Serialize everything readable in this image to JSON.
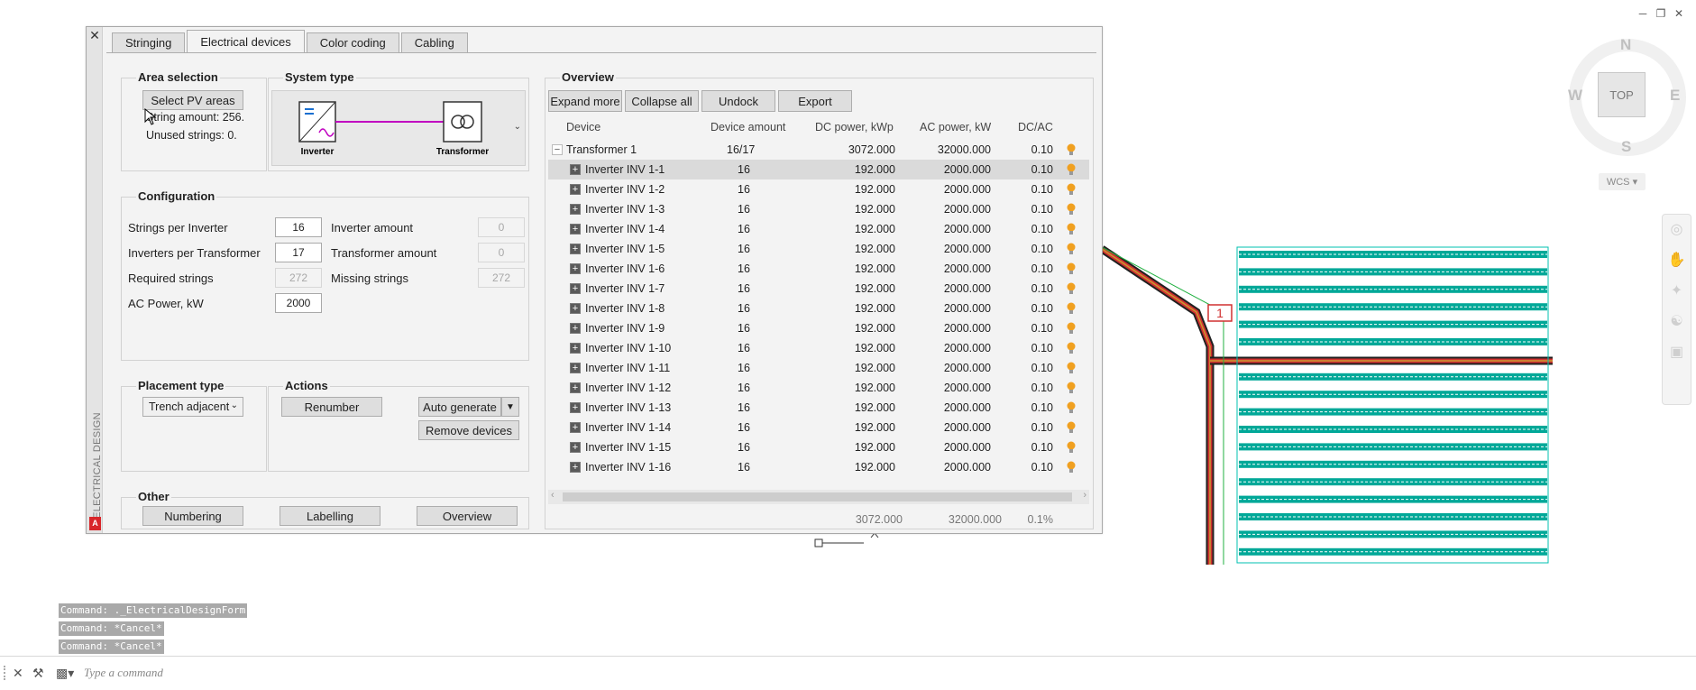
{
  "window_controls": [
    "minimize-icon",
    "restore-icon",
    "close-icon"
  ],
  "viewcube": {
    "top": "TOP",
    "n": "N",
    "s": "S",
    "e": "E",
    "w": "W",
    "wcs": "WCS"
  },
  "drawing": {
    "marker_label": "1"
  },
  "dialog": {
    "close": "✕",
    "side_label": "ELECTRICAL DESIGN",
    "logo": "A",
    "tabs": [
      "Stringing",
      "Electrical devices",
      "Color coding",
      "Cabling"
    ],
    "active_tab": 1,
    "area_selection": {
      "title": "Area selection",
      "select_button": "Select PV areas",
      "string_amount": "String amount: 256.",
      "unused_strings": "Unused strings: 0."
    },
    "system_type": {
      "title": "System type",
      "inverter_label": "Inverter",
      "transformer_label": "Transformer"
    },
    "configuration": {
      "title": "Configuration",
      "strings_per_inverter_label": "Strings per Inverter",
      "strings_per_inverter": "16",
      "inverters_per_transformer_label": "Inverters per Transformer",
      "inverters_per_transformer": "17",
      "required_strings_label": "Required strings",
      "required_strings": "272",
      "ac_power_label": "AC Power, kW",
      "ac_power": "2000",
      "inverter_amount_label": "Inverter amount",
      "inverter_amount": "0",
      "transformer_amount_label": "Transformer amount",
      "transformer_amount": "0",
      "missing_strings_label": "Missing strings",
      "missing_strings": "272"
    },
    "placement": {
      "title": "Placement type",
      "selected": "Trench adjacent"
    },
    "actions": {
      "title": "Actions",
      "renumber": "Renumber",
      "auto_generate": "Auto generate",
      "remove_devices": "Remove devices"
    },
    "other": {
      "title": "Other",
      "numbering": "Numbering",
      "labelling": "Labelling",
      "overview": "Overview"
    },
    "overview": {
      "title": "Overview",
      "expand_more": "Expand more",
      "collapse_all": "Collapse all",
      "undock": "Undock",
      "export": "Export",
      "columns": [
        "Device",
        "Device amount",
        "DC power, kWp",
        "AC power, kW",
        "DC/AC"
      ],
      "transformer_row": {
        "device": "Transformer 1",
        "amount": "16/17",
        "dc": "3072.000",
        "ac": "32000.000",
        "ratio": "0.10"
      },
      "rows": [
        {
          "device": "Inverter INV 1-1",
          "amount": "16",
          "dc": "192.000",
          "ac": "2000.000",
          "ratio": "0.10"
        },
        {
          "device": "Inverter INV 1-2",
          "amount": "16",
          "dc": "192.000",
          "ac": "2000.000",
          "ratio": "0.10"
        },
        {
          "device": "Inverter INV 1-3",
          "amount": "16",
          "dc": "192.000",
          "ac": "2000.000",
          "ratio": "0.10"
        },
        {
          "device": "Inverter INV 1-4",
          "amount": "16",
          "dc": "192.000",
          "ac": "2000.000",
          "ratio": "0.10"
        },
        {
          "device": "Inverter INV 1-5",
          "amount": "16",
          "dc": "192.000",
          "ac": "2000.000",
          "ratio": "0.10"
        },
        {
          "device": "Inverter INV 1-6",
          "amount": "16",
          "dc": "192.000",
          "ac": "2000.000",
          "ratio": "0.10"
        },
        {
          "device": "Inverter INV 1-7",
          "amount": "16",
          "dc": "192.000",
          "ac": "2000.000",
          "ratio": "0.10"
        },
        {
          "device": "Inverter INV 1-8",
          "amount": "16",
          "dc": "192.000",
          "ac": "2000.000",
          "ratio": "0.10"
        },
        {
          "device": "Inverter INV 1-9",
          "amount": "16",
          "dc": "192.000",
          "ac": "2000.000",
          "ratio": "0.10"
        },
        {
          "device": "Inverter INV 1-10",
          "amount": "16",
          "dc": "192.000",
          "ac": "2000.000",
          "ratio": "0.10"
        },
        {
          "device": "Inverter INV 1-11",
          "amount": "16",
          "dc": "192.000",
          "ac": "2000.000",
          "ratio": "0.10"
        },
        {
          "device": "Inverter INV 1-12",
          "amount": "16",
          "dc": "192.000",
          "ac": "2000.000",
          "ratio": "0.10"
        },
        {
          "device": "Inverter INV 1-13",
          "amount": "16",
          "dc": "192.000",
          "ac": "2000.000",
          "ratio": "0.10"
        },
        {
          "device": "Inverter INV 1-14",
          "amount": "16",
          "dc": "192.000",
          "ac": "2000.000",
          "ratio": "0.10"
        },
        {
          "device": "Inverter INV 1-15",
          "amount": "16",
          "dc": "192.000",
          "ac": "2000.000",
          "ratio": "0.10"
        },
        {
          "device": "Inverter INV 1-16",
          "amount": "16",
          "dc": "192.000",
          "ac": "2000.000",
          "ratio": "0.10"
        }
      ],
      "totals": {
        "dc": "3072.000",
        "ac": "32000.000",
        "ratio": "0.1%"
      }
    }
  },
  "command_history": [
    "Command: ._ElectricalDesignForm",
    "Command: *Cancel*",
    "Command: *Cancel*"
  ],
  "command_placeholder": "Type a command",
  "colors": {
    "accent_line": "#c000c0",
    "bulb": "#f0a020",
    "pv_area": "#00b0a0",
    "trench_red": "#d03030"
  }
}
